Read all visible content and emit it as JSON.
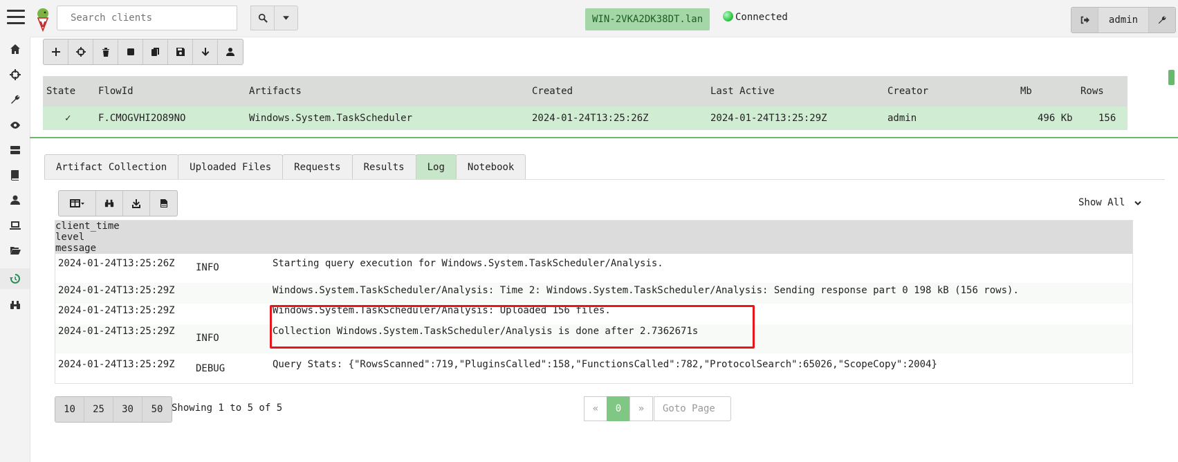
{
  "topbar": {
    "search_placeholder": "Search clients",
    "hostname": "WIN-2VKA2DK38DT.lan",
    "connection_status": "Connected",
    "username": "admin"
  },
  "sidebar": {
    "items": [
      "home-icon",
      "crosshair-icon",
      "wrench-icon",
      "eye-icon",
      "server-icon",
      "book-icon",
      "user-icon",
      "laptop-icon",
      "folder-open-icon",
      "history-icon",
      "binoculars-icon"
    ],
    "active": "history-icon"
  },
  "flows": {
    "headers": [
      "State",
      "FlowId",
      "Artifacts",
      "Created",
      "Last Active",
      "Creator",
      "Mb",
      "Rows"
    ],
    "rows": [
      {
        "state": "✓",
        "flow_id": "F.CMOGVHI2O89NO",
        "artifacts": "Windows.System.TaskScheduler",
        "created": "2024-01-24T13:25:26Z",
        "last_active": "2024-01-24T13:25:29Z",
        "creator": "admin",
        "mb": "496 Kb",
        "rows": "156"
      }
    ]
  },
  "tabs": [
    "Artifact Collection",
    "Uploaded Files",
    "Requests",
    "Results",
    "Log",
    "Notebook"
  ],
  "active_tab": "Log",
  "log": {
    "show_filter": "Show All",
    "headers": [
      "client_time",
      "level",
      "message"
    ],
    "rows": [
      {
        "client_time": "2024-01-24T13:25:26Z",
        "level": "INFO",
        "message": "Starting query execution for Windows.System.TaskScheduler/Analysis."
      },
      {
        "client_time": "2024-01-24T13:25:29Z",
        "level": "",
        "message": "Windows.System.TaskScheduler/Analysis: Time 2: Windows.System.TaskScheduler/Analysis: Sending response part 0 198 kB (156 rows)."
      },
      {
        "client_time": "2024-01-24T13:25:29Z",
        "level": "",
        "message": "Windows.System.TaskScheduler/Analysis: Uploaded 156 files."
      },
      {
        "client_time": "2024-01-24T13:25:29Z",
        "level": "INFO",
        "message": "Collection Windows.System.TaskScheduler/Analysis is done after 2.7362671s"
      },
      {
        "client_time": "2024-01-24T13:25:29Z",
        "level": "DEBUG",
        "message": "Query Stats: {\"RowsScanned\":719,\"PluginsCalled\":158,\"FunctionsCalled\":782,\"ProtocolSearch\":65026,\"ScopeCopy\":2004}"
      }
    ]
  },
  "pagination": {
    "sizes": [
      "10",
      "25",
      "30",
      "50"
    ],
    "showing": "Showing 1 to 5 of 5",
    "prev": "«",
    "current": "0",
    "next": "»",
    "goto_placeholder": "Goto Page"
  },
  "colors": {
    "accent": "#66bb6a",
    "selected_row": "#d0ecd2",
    "highlight_box": "#e8161b"
  }
}
